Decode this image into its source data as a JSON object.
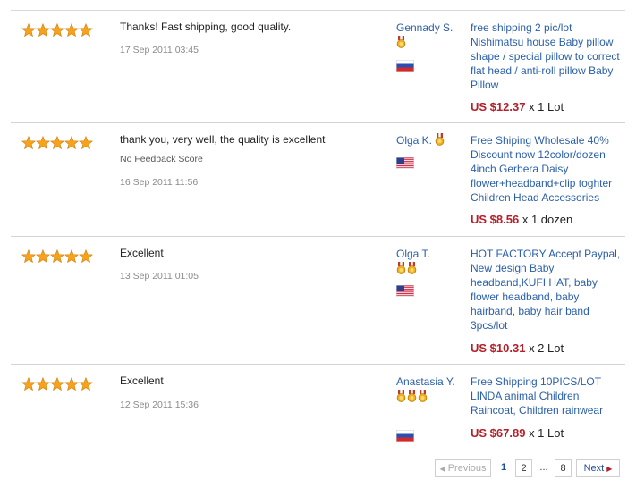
{
  "colors": {
    "link": "#2a5fa8",
    "price": "#b3202a",
    "star": "#f7a21b",
    "divider": "#d4d4d4"
  },
  "rating_icon": "star-icon",
  "reviews": [
    {
      "stars": 5,
      "feedback": "Thanks! Fast shipping, good quality.",
      "date": "17 Sep 2011 03:45",
      "buyer": "Gennady S.",
      "medals": 1,
      "flag": "russia-flag-icon",
      "product": "free shipping 2 pic/lot Nishimatsu house Baby pillow shape / special pillow to correct flat head / anti-roll pillow Baby Pillow",
      "price": "US $12.37",
      "quantity": "x 1 Lot"
    },
    {
      "stars": 5,
      "feedback": "thank you, very well, the quality is excellent",
      "score_note": "No Feedback Score",
      "date": "16 Sep 2011 11:56",
      "buyer": "Olga K.",
      "medals": 1,
      "flag": "usa-flag-icon",
      "product": "Free Shiping Wholesale 40% Discount now 12color/dozen 4inch Gerbera Daisy flower+headband+clip toghter Children Head Accessories",
      "price": "US $8.56",
      "quantity": "x 1 dozen"
    },
    {
      "stars": 5,
      "feedback": "Excellent",
      "date": "13 Sep 2011 01:05",
      "buyer": "Olga T.",
      "medals": 2,
      "flag": "usa-flag-icon",
      "product": "HOT FACTORY Accept Paypal, New design Baby headband,KUFI HAT, baby flower headband, baby hairband, baby hair band 3pcs/lot",
      "price": "US $10.31",
      "quantity": "x 2 Lot"
    },
    {
      "stars": 5,
      "feedback": "Excellent",
      "date": "12 Sep 2011 15:36",
      "buyer": "Anastasia Y.",
      "medals": 3,
      "flag": "russia-flag-icon",
      "product": "Free Shipping 10PICS/LOT LINDA animal Children Raincoat, Children rainwear",
      "price": "US $67.89",
      "quantity": "x 1 Lot"
    }
  ],
  "pagination": {
    "prev": "Previous",
    "current": "1",
    "page2": "2",
    "dots": "...",
    "last": "8",
    "next": "Next"
  }
}
